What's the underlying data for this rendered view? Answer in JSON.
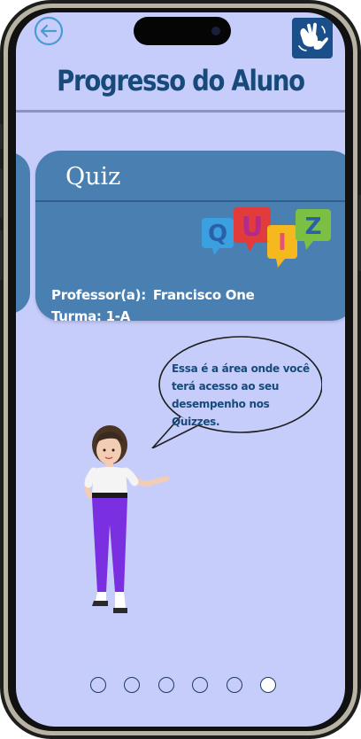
{
  "header": {
    "title": "Progresso do Aluno",
    "back_icon": "arrow-left-circle-icon",
    "accessibility_icon": "sign-language-hands-icon"
  },
  "card": {
    "title": "Quiz",
    "logo_letters": [
      "Q",
      "U",
      "I",
      "Z"
    ],
    "teacher_label": "Professor(a):",
    "teacher_name": "Francisco One",
    "class_label": "Turma:",
    "class_name": "1-A"
  },
  "assistant": {
    "message": "Essa é a área onde você terá acesso ao seu desempenho nos Quizzes."
  },
  "pagination": {
    "total": 6,
    "active_index": 5
  },
  "colors": {
    "background": "#c6cdfb",
    "card": "#4a7fb1",
    "title": "#174a7a",
    "accent": "#1b4f8a"
  }
}
